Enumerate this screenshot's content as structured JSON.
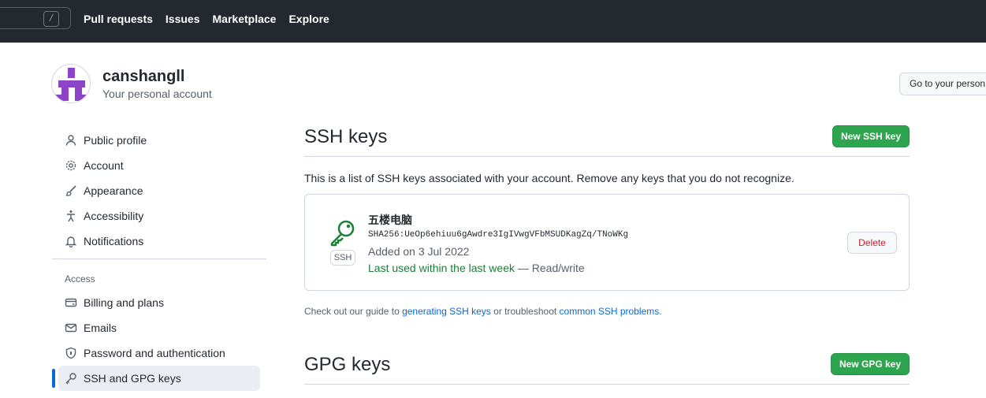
{
  "topbar": {
    "search_shortcut": "/",
    "nav": [
      "Pull requests",
      "Issues",
      "Marketplace",
      "Explore"
    ]
  },
  "account": {
    "name": "canshangll",
    "subtitle": "Your personal account",
    "go_button": "Go to your person"
  },
  "sidebar": {
    "items": [
      {
        "label": "Public profile",
        "icon": "person-icon"
      },
      {
        "label": "Account",
        "icon": "gear-icon"
      },
      {
        "label": "Appearance",
        "icon": "paintbrush-icon"
      },
      {
        "label": "Accessibility",
        "icon": "accessibility-icon"
      },
      {
        "label": "Notifications",
        "icon": "bell-icon"
      }
    ],
    "access_heading": "Access",
    "access_items": [
      {
        "label": "Billing and plans",
        "icon": "credit-card-icon"
      },
      {
        "label": "Emails",
        "icon": "mail-icon"
      },
      {
        "label": "Password and authentication",
        "icon": "shield-lock-icon"
      },
      {
        "label": "SSH and GPG keys",
        "icon": "key-icon",
        "active": true
      }
    ]
  },
  "ssh": {
    "title": "SSH keys",
    "new_button": "New SSH key",
    "description": "This is a list of SSH keys associated with your account. Remove any keys that you do not recognize.",
    "key": {
      "name": "五楼电脑",
      "fingerprint": "SHA256:UeOp6ehiuu6gAwdre3IgIVwgVFbMSUDKagZq/TNoWKg",
      "badge": "SSH",
      "added": "Added on 3 Jul 2022",
      "last_used": "Last used within the last week",
      "access": " — Read/write",
      "delete_button": "Delete"
    },
    "guide_prefix": "Check out our guide to ",
    "guide_link1": "generating SSH keys",
    "guide_mid": " or troubleshoot ",
    "guide_link2": "common SSH problems",
    "guide_suffix": "."
  },
  "gpg": {
    "title": "GPG keys",
    "new_button": "New GPG key"
  },
  "colors": {
    "topbar": "#24292f",
    "green_button": "#2da44e",
    "link": "#0969da",
    "danger": "#cf222e",
    "active_bar": "#0969da"
  }
}
